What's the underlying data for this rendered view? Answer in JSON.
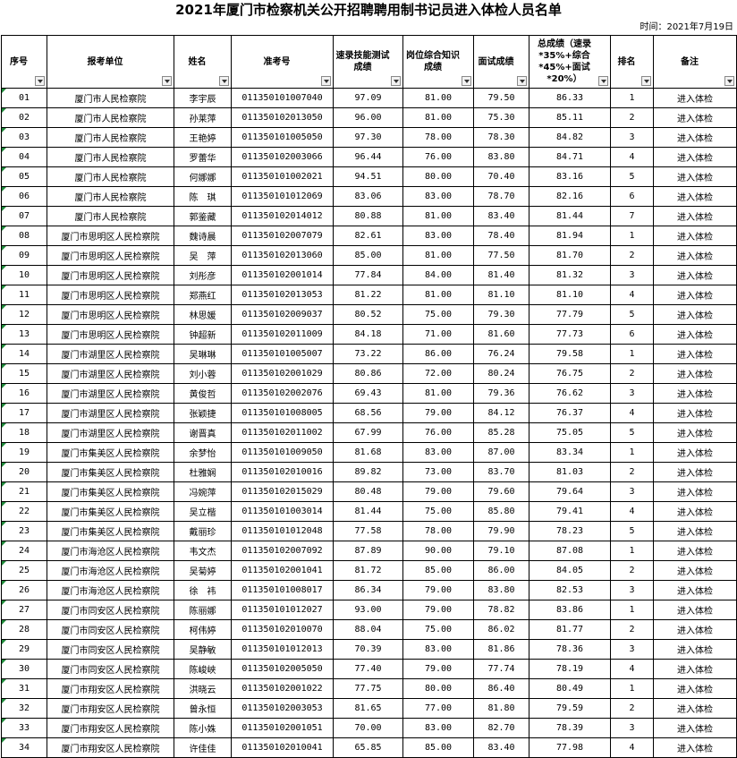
{
  "title": "2021年厦门市检察机关公开招聘聘用制书记员进入体检人员名单",
  "date": "时间：2021年7月19日",
  "columns": [
    "序号",
    "报考单位",
    "姓名",
    "准考号",
    "速录技能测试成绩",
    "岗位综合知识成绩",
    "面试成绩",
    "总成绩（速录*35%+综合*45%+面试*20%）",
    "排名",
    "备注"
  ],
  "rows": [
    [
      "01",
      "厦门市人民检察院",
      "李宇辰",
      "011350101007040",
      "97.09",
      "81.00",
      "79.50",
      "86.33",
      "1",
      "进入体检"
    ],
    [
      "02",
      "厦门市人民检察院",
      "孙莱萍",
      "011350102013050",
      "96.00",
      "81.00",
      "75.30",
      "85.11",
      "2",
      "进入体检"
    ],
    [
      "03",
      "厦门市人民检察院",
      "王艳婷",
      "011350101005050",
      "97.30",
      "78.00",
      "78.30",
      "84.82",
      "3",
      "进入体检"
    ],
    [
      "04",
      "厦门市人民检察院",
      "罗蕾华",
      "011350102003066",
      "96.44",
      "76.00",
      "83.80",
      "84.71",
      "4",
      "进入体检"
    ],
    [
      "05",
      "厦门市人民检察院",
      "何娜娜",
      "011350101002021",
      "94.51",
      "80.00",
      "70.40",
      "83.16",
      "5",
      "进入体检"
    ],
    [
      "06",
      "厦门市人民检察院",
      "陈　琪",
      "011350101012069",
      "83.06",
      "83.00",
      "78.70",
      "82.16",
      "6",
      "进入体检"
    ],
    [
      "07",
      "厦门市人民检察院",
      "郭鉴藏",
      "011350102014012",
      "80.88",
      "81.00",
      "83.40",
      "81.44",
      "7",
      "进入体检"
    ],
    [
      "08",
      "厦门市思明区人民检察院",
      "魏诗晨",
      "011350102007079",
      "82.61",
      "83.00",
      "78.40",
      "81.94",
      "1",
      "进入体检"
    ],
    [
      "09",
      "厦门市思明区人民检察院",
      "吴　萍",
      "011350102013060",
      "85.00",
      "81.00",
      "77.50",
      "81.70",
      "2",
      "进入体检"
    ],
    [
      "10",
      "厦门市思明区人民检察院",
      "刘彤彦",
      "011350102001014",
      "77.84",
      "84.00",
      "81.40",
      "81.32",
      "3",
      "进入体检"
    ],
    [
      "11",
      "厦门市思明区人民检察院",
      "郑燕红",
      "011350102013053",
      "81.22",
      "81.00",
      "81.10",
      "81.10",
      "4",
      "进入体检"
    ],
    [
      "12",
      "厦门市思明区人民检察院",
      "林思媛",
      "011350102009037",
      "80.52",
      "75.00",
      "79.30",
      "77.79",
      "5",
      "进入体检"
    ],
    [
      "13",
      "厦门市思明区人民检察院",
      "钟超新",
      "011350102011009",
      "84.18",
      "71.00",
      "81.60",
      "77.73",
      "6",
      "进入体检"
    ],
    [
      "14",
      "厦门市湖里区人民检察院",
      "吴琳琳",
      "011350101005007",
      "73.22",
      "86.00",
      "76.24",
      "79.58",
      "1",
      "进入体检"
    ],
    [
      "15",
      "厦门市湖里区人民检察院",
      "刘小蓉",
      "011350102001029",
      "80.86",
      "72.00",
      "80.24",
      "76.75",
      "2",
      "进入体检"
    ],
    [
      "16",
      "厦门市湖里区人民检察院",
      "黄俊哲",
      "011350102002076",
      "69.43",
      "81.00",
      "79.36",
      "76.62",
      "3",
      "进入体检"
    ],
    [
      "17",
      "厦门市湖里区人民检察院",
      "张颖捷",
      "011350101008005",
      "68.56",
      "79.00",
      "84.12",
      "76.37",
      "4",
      "进入体检"
    ],
    [
      "18",
      "厦门市湖里区人民检察院",
      "谢晋真",
      "011350102011002",
      "67.99",
      "76.00",
      "85.28",
      "75.05",
      "5",
      "进入体检"
    ],
    [
      "19",
      "厦门市集美区人民检察院",
      "余梦怡",
      "011350101009050",
      "81.68",
      "83.00",
      "87.00",
      "83.34",
      "1",
      "进入体检"
    ],
    [
      "20",
      "厦门市集美区人民检察院",
      "杜雅娴",
      "011350102010016",
      "89.82",
      "73.00",
      "83.70",
      "81.03",
      "2",
      "进入体检"
    ],
    [
      "21",
      "厦门市集美区人民检察院",
      "冯婉萍",
      "011350102015029",
      "80.48",
      "79.00",
      "79.60",
      "79.64",
      "3",
      "进入体检"
    ],
    [
      "22",
      "厦门市集美区人民检察院",
      "吴立楷",
      "011350101003014",
      "81.44",
      "75.00",
      "85.80",
      "79.41",
      "4",
      "进入体检"
    ],
    [
      "23",
      "厦门市集美区人民检察院",
      "戴丽珍",
      "011350101012048",
      "77.58",
      "78.00",
      "79.90",
      "78.23",
      "5",
      "进入体检"
    ],
    [
      "24",
      "厦门市海沧区人民检察院",
      "韦文杰",
      "011350102007092",
      "87.89",
      "90.00",
      "79.10",
      "87.08",
      "1",
      "进入体检"
    ],
    [
      "25",
      "厦门市海沧区人民检察院",
      "吴菊婷",
      "011350102001041",
      "81.72",
      "85.00",
      "86.00",
      "84.05",
      "2",
      "进入体检"
    ],
    [
      "26",
      "厦门市海沧区人民检察院",
      "徐　祎",
      "011350101008017",
      "86.34",
      "79.00",
      "83.80",
      "82.53",
      "3",
      "进入体检"
    ],
    [
      "27",
      "厦门市同安区人民检察院",
      "陈丽娜",
      "011350101012027",
      "93.00",
      "79.00",
      "78.82",
      "83.86",
      "1",
      "进入体检"
    ],
    [
      "28",
      "厦门市同安区人民检察院",
      "柯伟婷",
      "011350102010070",
      "88.04",
      "75.00",
      "86.02",
      "81.77",
      "2",
      "进入体检"
    ],
    [
      "29",
      "厦门市同安区人民检察院",
      "吴静敏",
      "011350101012013",
      "70.39",
      "83.00",
      "81.86",
      "78.36",
      "3",
      "进入体检"
    ],
    [
      "30",
      "厦门市同安区人民检察院",
      "陈峻峡",
      "011350102005050",
      "77.40",
      "79.00",
      "77.74",
      "78.19",
      "4",
      "进入体检"
    ],
    [
      "31",
      "厦门市翔安区人民检察院",
      "洪晓云",
      "011350102001022",
      "77.75",
      "80.00",
      "86.40",
      "80.49",
      "1",
      "进入体检"
    ],
    [
      "32",
      "厦门市翔安区人民检察院",
      "曾永恒",
      "011350102003053",
      "81.65",
      "77.00",
      "81.80",
      "79.59",
      "2",
      "进入体检"
    ],
    [
      "33",
      "厦门市翔安区人民检察院",
      "陈小姝",
      "011350102001051",
      "70.00",
      "83.00",
      "82.70",
      "78.39",
      "3",
      "进入体检"
    ],
    [
      "34",
      "厦门市翔安区人民检察院",
      "许佳佳",
      "011350102010041",
      "65.85",
      "85.00",
      "83.40",
      "77.98",
      "4",
      "进入体检"
    ]
  ]
}
